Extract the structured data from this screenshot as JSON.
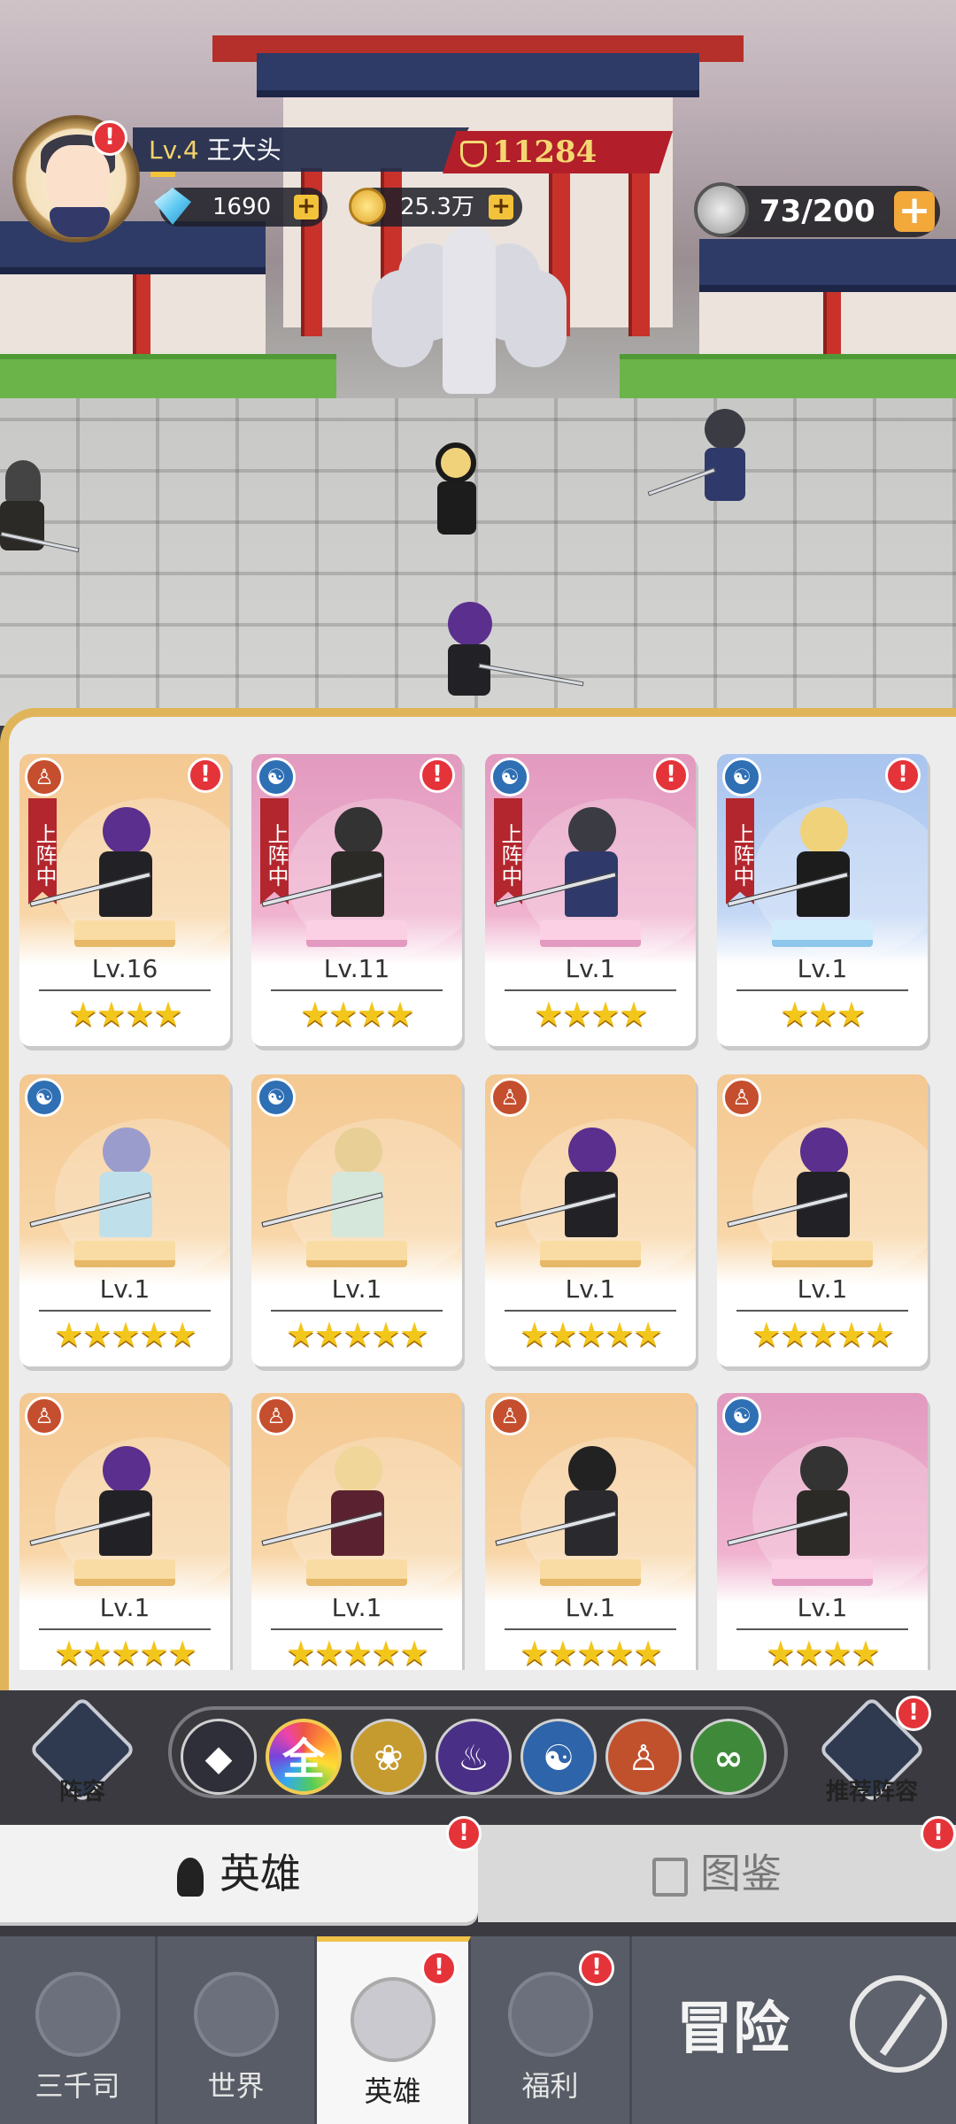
{
  "player": {
    "level_prefix": "Lv.4",
    "name": "王大头",
    "power": "11284"
  },
  "resources": {
    "gems": "1690",
    "gold": "25.3万",
    "stamina": "73/200"
  },
  "icons": {
    "gem": "diamond-icon",
    "gold": "coin-icon",
    "power": "shield-icon",
    "stamina": "stamina-icon",
    "alert": "!",
    "plus": "+"
  },
  "deploy_label": "上阵中",
  "heroes": [
    {
      "faction": "fire",
      "bg": "orange",
      "level": "Lv.16",
      "stars": 4,
      "deployed": true,
      "alert": true,
      "hair": "#5b2f8e",
      "body": "#222226"
    },
    {
      "faction": "water",
      "bg": "pink",
      "level": "Lv.11",
      "stars": 4,
      "deployed": true,
      "alert": true,
      "hair": "#333",
      "body": "#2c2a26"
    },
    {
      "faction": "water",
      "bg": "pink",
      "level": "Lv.1",
      "stars": 4,
      "deployed": true,
      "alert": true,
      "hair": "#3b3b44",
      "body": "#2f3a6a"
    },
    {
      "faction": "water",
      "bg": "blue",
      "level": "Lv.1",
      "stars": 3,
      "deployed": true,
      "alert": true,
      "hair": "#f0d27a",
      "body": "#1c1c1c"
    },
    {
      "faction": "water",
      "bg": "orange",
      "level": "Lv.1",
      "stars": 5,
      "deployed": false,
      "alert": false,
      "hair": "#9a9ccc",
      "body": "#bfe0ea"
    },
    {
      "faction": "water",
      "bg": "orange",
      "level": "Lv.1",
      "stars": 5,
      "deployed": false,
      "alert": false,
      "hair": "#e8cf96",
      "body": "#d5e6da"
    },
    {
      "faction": "fire",
      "bg": "orange",
      "level": "Lv.1",
      "stars": 5,
      "deployed": false,
      "alert": false,
      "hair": "#5b2f8e",
      "body": "#222226"
    },
    {
      "faction": "fire",
      "bg": "orange",
      "level": "Lv.1",
      "stars": 5,
      "deployed": false,
      "alert": false,
      "hair": "#5b2f8e",
      "body": "#222226"
    },
    {
      "faction": "fire",
      "bg": "orange",
      "level": "Lv.1",
      "stars": 5,
      "deployed": false,
      "alert": false,
      "hair": "#5b2f8e",
      "body": "#222226"
    },
    {
      "faction": "fire",
      "bg": "orange",
      "level": "Lv.1",
      "stars": 5,
      "deployed": false,
      "alert": false,
      "hair": "#f1d69a",
      "body": "#5a2230"
    },
    {
      "faction": "fire",
      "bg": "orange",
      "level": "Lv.1",
      "stars": 5,
      "deployed": false,
      "alert": false,
      "hair": "#222",
      "body": "#2a2a2e"
    },
    {
      "faction": "water",
      "bg": "pink",
      "level": "Lv.1",
      "stars": 4,
      "deployed": false,
      "alert": false,
      "hair": "#333",
      "body": "#2c2a26"
    }
  ],
  "filter": {
    "all_label": "全",
    "buttons": [
      {
        "name": "rank-filter",
        "color": "#2e2f38",
        "glyph": "◆"
      },
      {
        "name": "all-filter",
        "color": "conic",
        "glyph": "全"
      },
      {
        "name": "lotus-filter",
        "color": "#c59a2e",
        "glyph": "❀"
      },
      {
        "name": "shadow-filter",
        "color": "#4a2f86",
        "glyph": "♨"
      },
      {
        "name": "water-filter",
        "color": "#2d64aa",
        "glyph": "☯"
      },
      {
        "name": "fire-filter",
        "color": "#c1502d",
        "glyph": "♙"
      },
      {
        "name": "wind-filter",
        "color": "#3f8a3a",
        "glyph": "∞"
      }
    ]
  },
  "side": {
    "lineup": "阵容",
    "recommend": "推荐阵容"
  },
  "tabs": {
    "heroes": "英雄",
    "codex": "图鉴"
  },
  "nav": {
    "sanqiansi": "三千司",
    "world": "世界",
    "heroes": "英雄",
    "welfare": "福利",
    "adventure": "冒险"
  }
}
